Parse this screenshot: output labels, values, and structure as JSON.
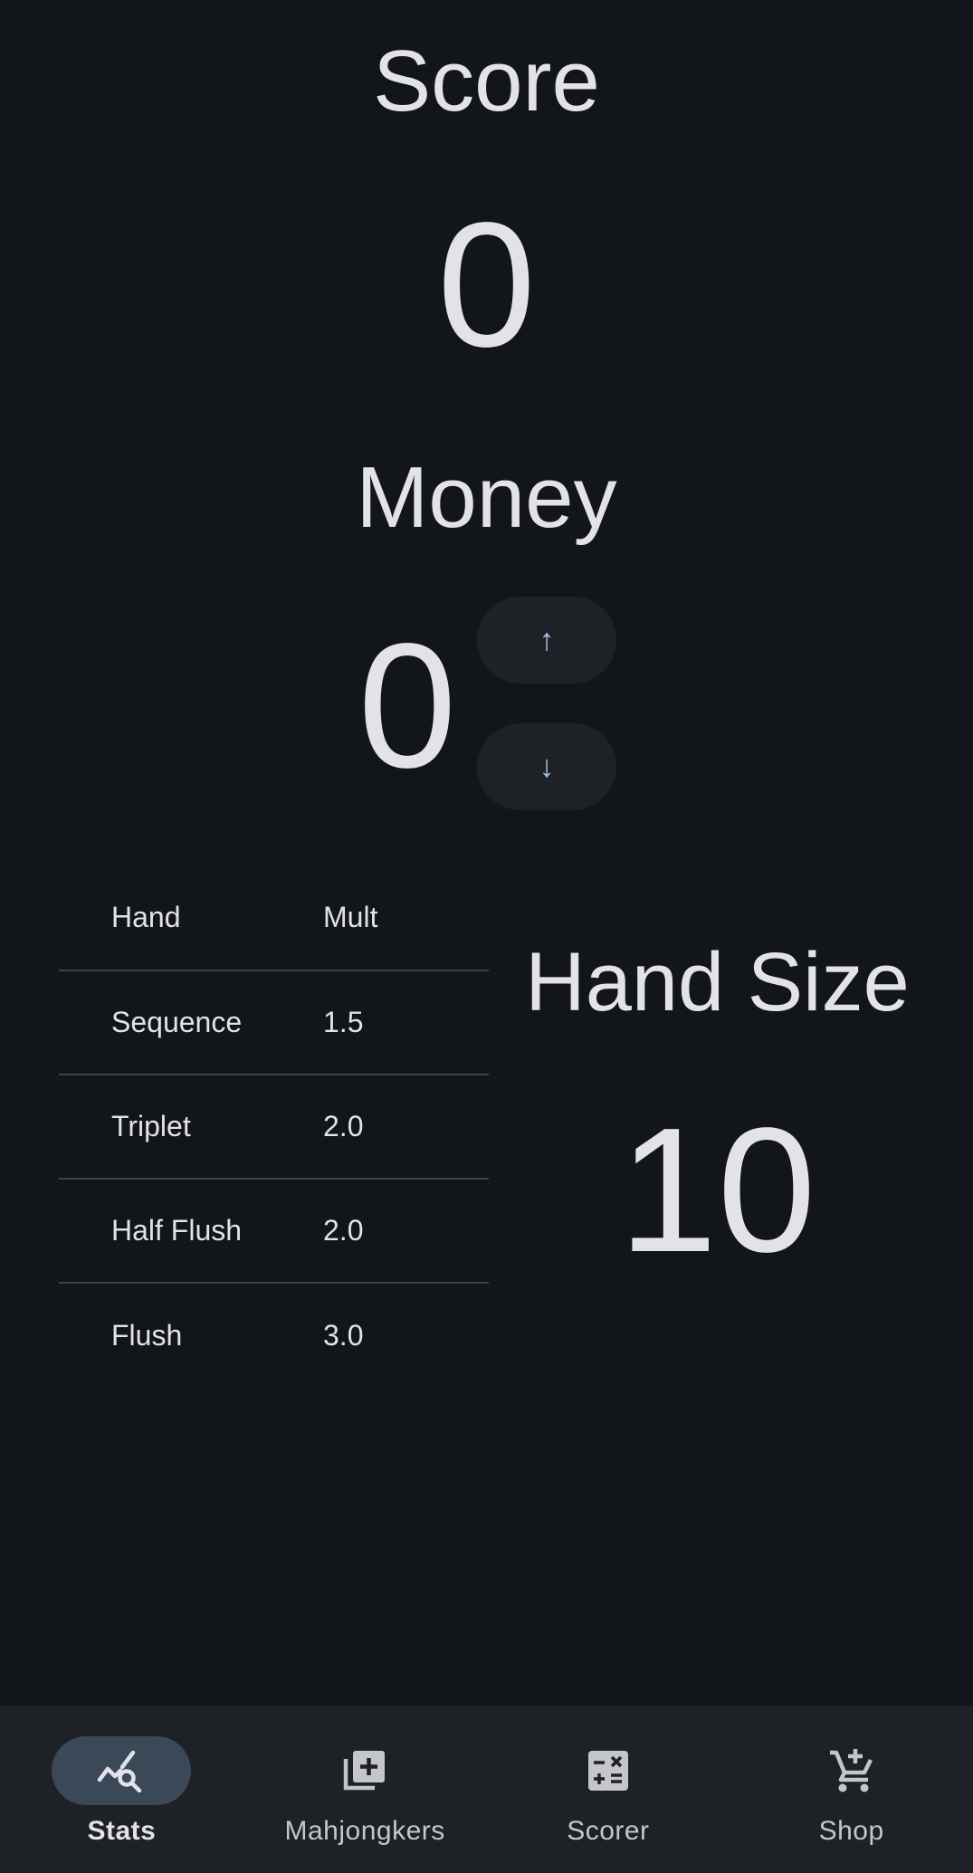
{
  "score": {
    "title": "Score",
    "value": "0"
  },
  "money": {
    "title": "Money",
    "value": "0",
    "up_label": "↑",
    "down_label": "↓"
  },
  "hands_table": {
    "headers": [
      "Hand",
      "Mult"
    ],
    "rows": [
      {
        "hand": "Sequence",
        "mult": "1.5"
      },
      {
        "hand": "Triplet",
        "mult": "2.0"
      },
      {
        "hand": "Half Flush",
        "mult": "2.0"
      },
      {
        "hand": "Flush",
        "mult": "3.0"
      }
    ]
  },
  "hand_size": {
    "title": "Hand Size",
    "value": "10"
  },
  "nav": {
    "items": [
      {
        "label": "Stats",
        "icon": "stats-search-icon",
        "active": true
      },
      {
        "label": "Mahjongkers",
        "icon": "library-add-icon",
        "active": false
      },
      {
        "label": "Scorer",
        "icon": "calculate-icon",
        "active": false
      },
      {
        "label": "Shop",
        "icon": "add-shopping-cart-icon",
        "active": false
      }
    ]
  },
  "colors": {
    "background": "#12151a",
    "nav_background": "#1e2126",
    "active_pill": "#3a4858",
    "accent_arrow": "#a8c8ea",
    "text": "#e2e2e8"
  }
}
